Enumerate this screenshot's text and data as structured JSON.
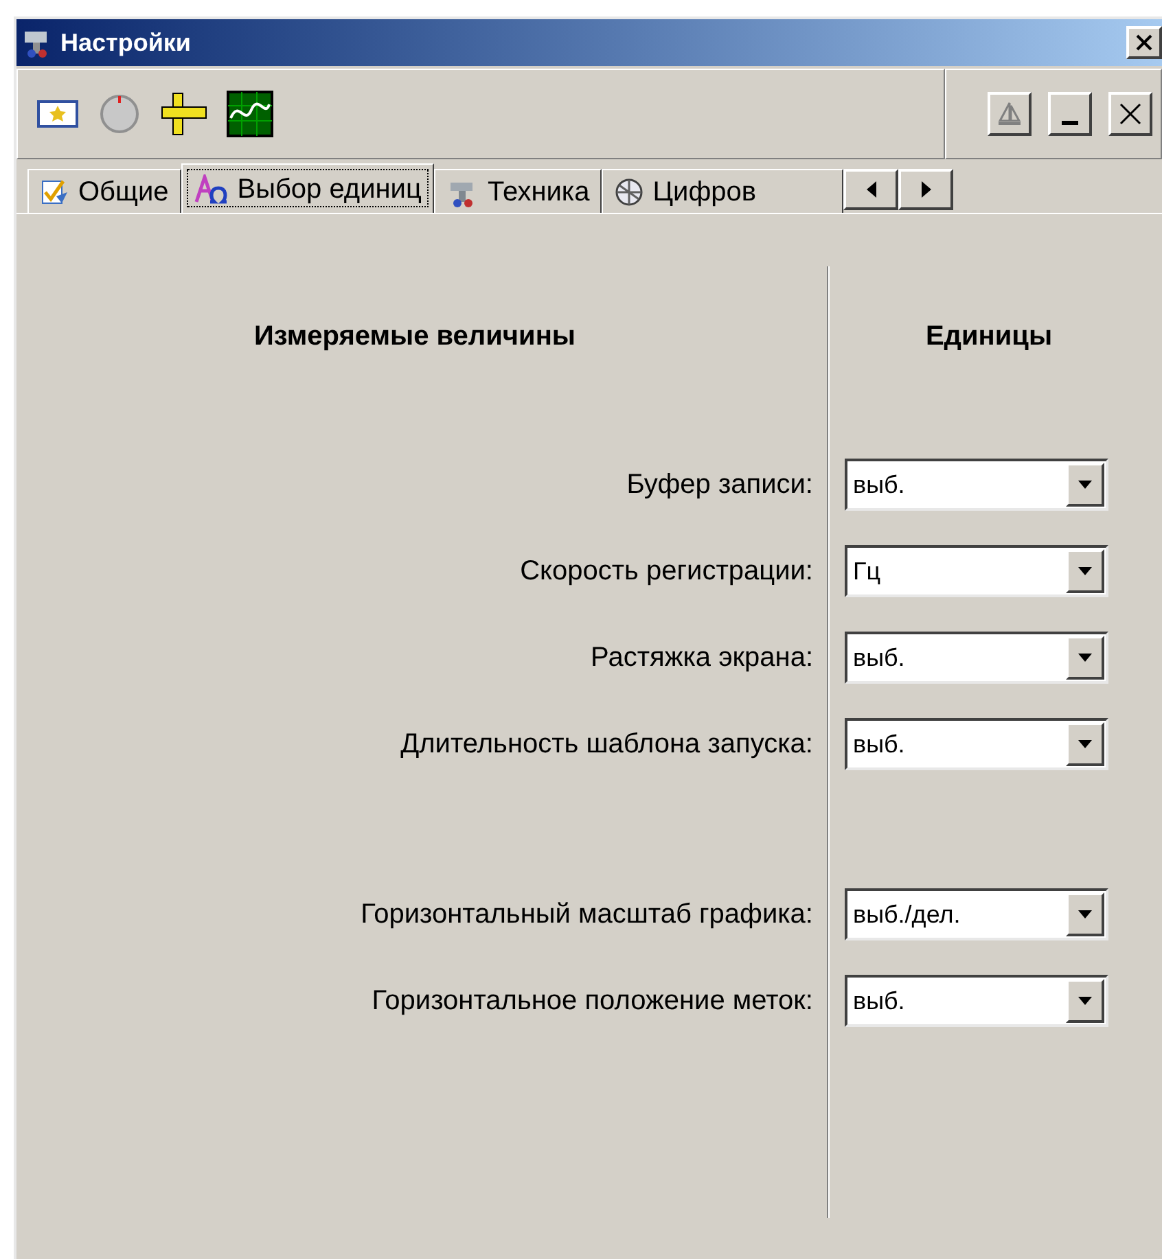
{
  "window": {
    "title": "Настройки"
  },
  "tabs": [
    {
      "label": "Общие",
      "selected": false,
      "kind": "check"
    },
    {
      "label": "Выбор единиц",
      "selected": true,
      "kind": "units"
    },
    {
      "label": "Техника",
      "selected": false,
      "kind": "tools"
    },
    {
      "label": "Цифров",
      "selected": false,
      "kind": "globe"
    }
  ],
  "headers": {
    "quantities": "Измеряемые величины",
    "units": "Единицы"
  },
  "groups": [
    [
      {
        "label": "Буфер записи:",
        "value": "выб."
      },
      {
        "label": "Скорость регистрации:",
        "value": "Гц"
      },
      {
        "label": "Растяжка экрана:",
        "value": "выб."
      },
      {
        "label": "Длительность шаблона запуска:",
        "value": "выб."
      }
    ],
    [
      {
        "label": "Горизонтальный масштаб графика:",
        "value": "выб./дел."
      },
      {
        "label": "Горизонтальное положение меток:",
        "value": "выб."
      }
    ]
  ]
}
